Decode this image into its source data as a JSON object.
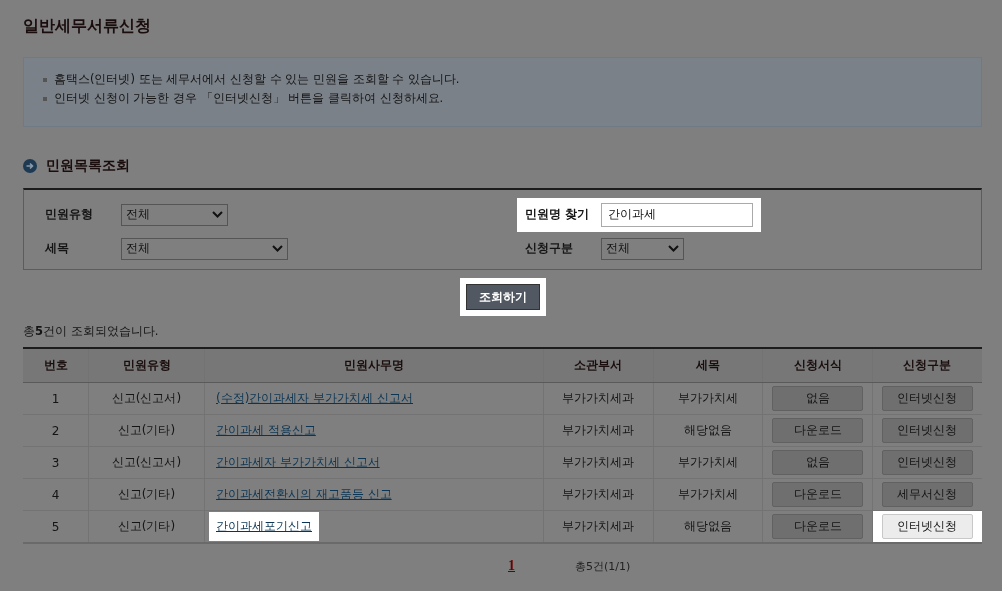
{
  "page_title": "일반세무서류신청",
  "notices": [
    "홈택스(인터넷) 또는 세무서에서 신청할 수 있는 민원을 조회할 수 있습니다.",
    "인터넷 신청이 가능한 경우 「인터넷신청」 버튼을 클릭하여 신청하세요."
  ],
  "section_title": "민원목록조회",
  "filters": [
    {
      "label": "민원유형",
      "kind": "select",
      "value": "전체",
      "highlighted": false
    },
    {
      "label": "민원명 찾기",
      "kind": "text",
      "value": "간이과세",
      "highlighted": true
    },
    {
      "label": "세목",
      "kind": "select",
      "value": "전체",
      "highlighted": false
    },
    {
      "label": "신청구분",
      "kind": "select",
      "value": "전체",
      "highlighted": false
    }
  ],
  "search_button": {
    "label": "조회하기",
    "highlighted": true
  },
  "result_summary": "총**5**건이 조회되었습니다.",
  "table": {
    "columns": [
      "번호",
      "민원유형",
      "민원사무명",
      "소관부서",
      "세목",
      "신청서식",
      "신청구분"
    ],
    "rows": [
      {
        "no": "1",
        "type": "신고(신고서)",
        "name": "(수정)간이과세자 부가가치세 신고서",
        "name_highlighted": false,
        "department": "부가가치세과",
        "tax": "부가가치세",
        "form": "없음",
        "apply": "인터넷신청",
        "apply_highlighted": false
      },
      {
        "no": "2",
        "type": "신고(기타)",
        "name": "간이과세 적용신고",
        "name_highlighted": false,
        "department": "부가가치세과",
        "tax": "해당없음",
        "form": "다운로드",
        "apply": "인터넷신청",
        "apply_highlighted": false
      },
      {
        "no": "3",
        "type": "신고(신고서)",
        "name": "간이과세자 부가가치세 신고서",
        "name_highlighted": false,
        "department": "부가가치세과",
        "tax": "부가가치세",
        "form": "없음",
        "apply": "인터넷신청",
        "apply_highlighted": false
      },
      {
        "no": "4",
        "type": "신고(기타)",
        "name": "간이과세전환시의 재고품등 신고",
        "name_highlighted": false,
        "department": "부가가치세과",
        "tax": "부가가치세",
        "form": "다운로드",
        "apply": "세무서신청",
        "apply_highlighted": false
      },
      {
        "no": "5",
        "type": "신고(기타)",
        "name": "간이과세포기신고",
        "name_highlighted": true,
        "department": "부가가치세과",
        "tax": "해당없음",
        "form": "다운로드",
        "apply": "인터넷신청",
        "apply_highlighted": true
      }
    ]
  },
  "pagination": {
    "pages": [
      {
        "label": "1",
        "selected": true
      }
    ],
    "summary": "총5건(1/1)"
  }
}
